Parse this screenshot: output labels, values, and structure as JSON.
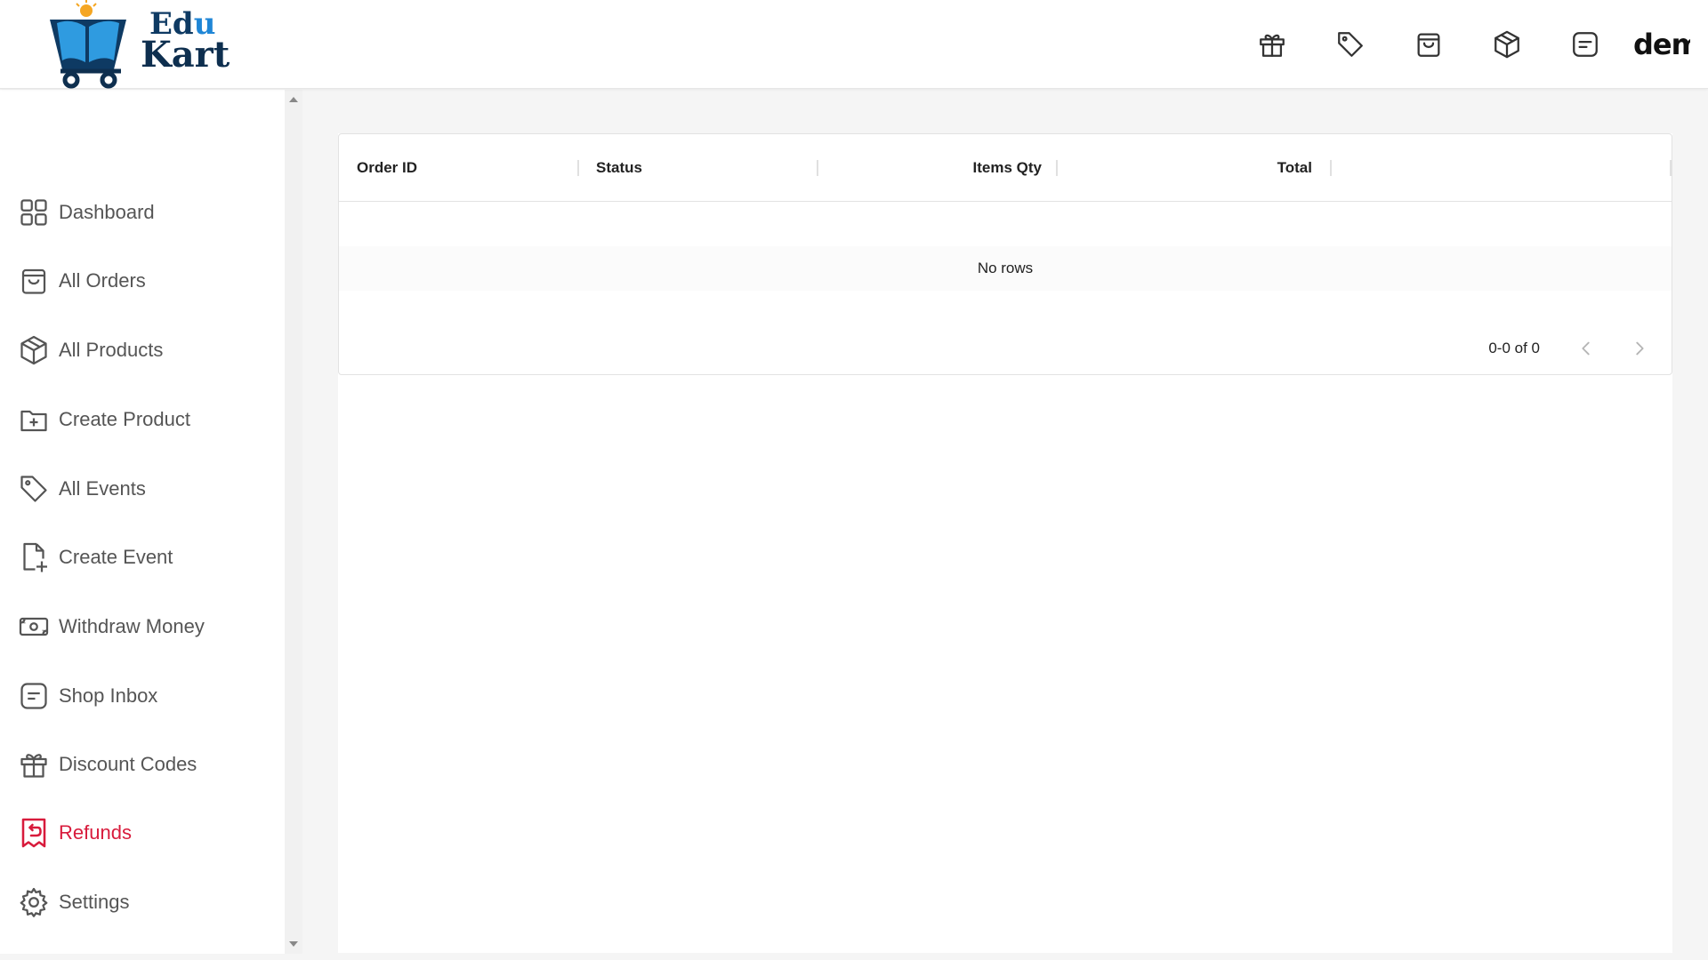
{
  "brand": {
    "line1_a": "Ed",
    "line1_b": "u",
    "line2": "Kart"
  },
  "header": {
    "icons": [
      "gift-icon",
      "tag-icon",
      "shopping-bag-icon",
      "package-icon",
      "message-icon"
    ],
    "username": "dem"
  },
  "sidebar": {
    "items": [
      {
        "label": "Dashboard",
        "icon": "dashboard-icon"
      },
      {
        "label": "All Orders",
        "icon": "shopping-bag-icon"
      },
      {
        "label": "All Products",
        "icon": "package-icon"
      },
      {
        "label": "Create Product",
        "icon": "folder-plus-icon"
      },
      {
        "label": "All Events",
        "icon": "tag-icon"
      },
      {
        "label": "Create Event",
        "icon": "file-plus-icon"
      },
      {
        "label": "Withdraw Money",
        "icon": "money-icon"
      },
      {
        "label": "Shop Inbox",
        "icon": "message-icon"
      },
      {
        "label": "Discount Codes",
        "icon": "gift-icon"
      },
      {
        "label": "Refunds",
        "icon": "receipt-refund-icon",
        "active": true
      },
      {
        "label": "Settings",
        "icon": "gear-icon"
      }
    ],
    "active_color": "#d81b3c"
  },
  "table": {
    "columns": [
      "Order ID",
      "Status",
      "Items Qty",
      "Total"
    ],
    "empty_text": "No rows",
    "pagination": "0-0 of 0"
  }
}
